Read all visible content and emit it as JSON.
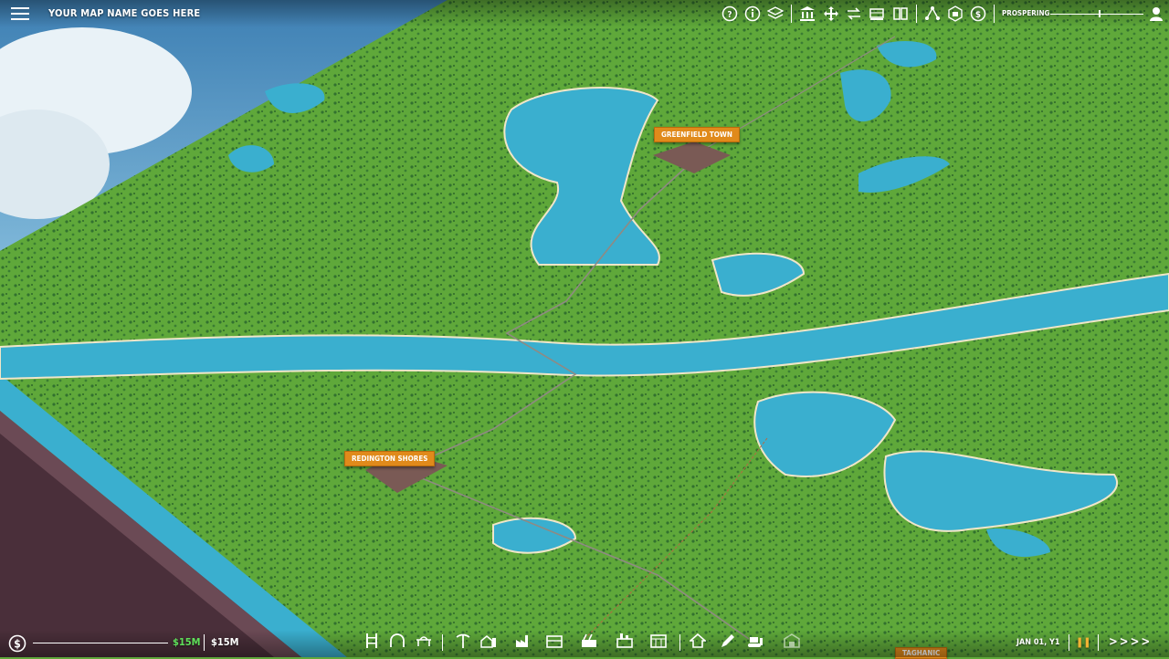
{
  "header": {
    "map_name": "YOUR MAP NAME GOES HERE",
    "status": "PROSPERING",
    "tools": [
      "help-icon",
      "info-icon",
      "layers-icon",
      "bank-icon",
      "move-icon",
      "trade-icon",
      "train-icon",
      "book-icon",
      "network-icon",
      "package-icon",
      "money-icon"
    ]
  },
  "map": {
    "towns": [
      {
        "name": "GREENFIELD TOWN"
      },
      {
        "name": "REDINGTON SHORES"
      },
      {
        "name": "TAGHANIC"
      }
    ]
  },
  "footer": {
    "money_current": "$15M",
    "money_total": "$15M",
    "date": "JAN 01, Y1",
    "speed": ">>>>",
    "build_tools": [
      "station-icon",
      "tunnel-icon",
      "bridge-icon",
      "mine-icon",
      "farm-icon",
      "factory-icon",
      "warehouse-icon",
      "sawmill-icon",
      "plant-icon",
      "depot-icon",
      "house-icon",
      "pen-icon",
      "bulldozer-icon",
      "shed-icon"
    ]
  },
  "colors": {
    "grass": "#5fa83a",
    "water": "#3aafcf",
    "label_bg": "#e08a1b",
    "money_green": "#5fe05a"
  }
}
